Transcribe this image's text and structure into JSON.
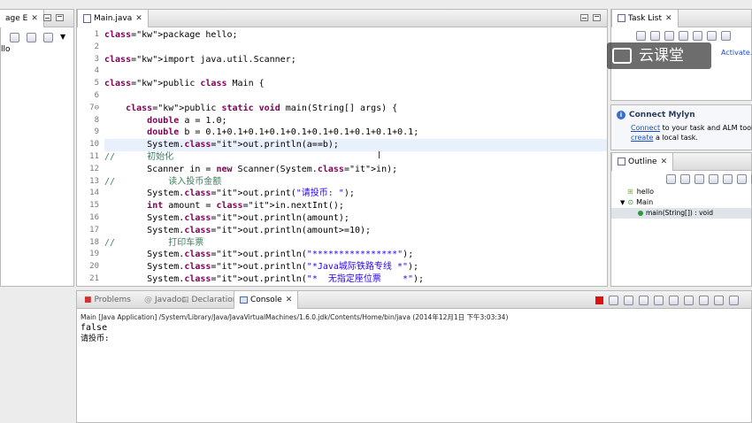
{
  "package_explorer": {
    "tab_label": "age E"
  },
  "package_tree": {
    "item": "llo"
  },
  "editor": {
    "tab_label": "Main.java",
    "lines": [
      {
        "n": "1",
        "t": "package hello;"
      },
      {
        "n": "2",
        "t": ""
      },
      {
        "n": "3",
        "t": "import java.util.Scanner;"
      },
      {
        "n": "4",
        "t": ""
      },
      {
        "n": "5",
        "t": "public class Main {"
      },
      {
        "n": "6",
        "t": ""
      },
      {
        "n": "7⊖",
        "t": "    public static void main(String[] args) {"
      },
      {
        "n": "8",
        "t": "        double a = 1.0;"
      },
      {
        "n": "9",
        "t": "        double b = 0.1+0.1+0.1+0.1+0.1+0.1+0.1+0.1+0.1+0.1;"
      },
      {
        "n": "10",
        "t": "        System.out.println(a==b);"
      },
      {
        "n": "11",
        "t": "//      初始化"
      },
      {
        "n": "12",
        "t": "        Scanner in = new Scanner(System.in);"
      },
      {
        "n": "13",
        "t": "//          读入投币金额"
      },
      {
        "n": "14",
        "t": "        System.out.print(\"请投币: \");"
      },
      {
        "n": "15",
        "t": "        int amount = in.nextInt();"
      },
      {
        "n": "16",
        "t": "        System.out.println(amount);"
      },
      {
        "n": "17",
        "t": "        System.out.println(amount>=10);"
      },
      {
        "n": "18",
        "t": "//          打印车票"
      },
      {
        "n": "19",
        "t": "        System.out.println(\"****************\");"
      },
      {
        "n": "20",
        "t": "        System.out.println(\"*Java城际铁路专线 *\");"
      },
      {
        "n": "21",
        "t": "        System.out.println(\"*  无指定座位票    *\");"
      }
    ]
  },
  "task_list": {
    "tab_label": "Task List",
    "activate_label": "Activate..."
  },
  "watermark": {
    "text": "云课堂"
  },
  "mylyn": {
    "title": "Connect Mylyn",
    "line1_link": "Connect",
    "line1_rest": " to your task and ALM tools",
    "line2_link": "create",
    "line2_rest": " a local task."
  },
  "outline": {
    "tab_label": "Outline",
    "items": [
      {
        "label": "hello"
      },
      {
        "label": "Main"
      },
      {
        "label": "main(String[]) : void"
      }
    ]
  },
  "console": {
    "tabs": [
      "Problems",
      "Javadoc",
      "Declaration",
      "Console"
    ],
    "header": "Main [Java Application] /System/Library/Java/JavaVirtualMachines/1.6.0.jdk/Contents/Home/bin/java (2014年12月1日 下午3:03:34)",
    "output": [
      "false",
      "请投币: "
    ]
  }
}
